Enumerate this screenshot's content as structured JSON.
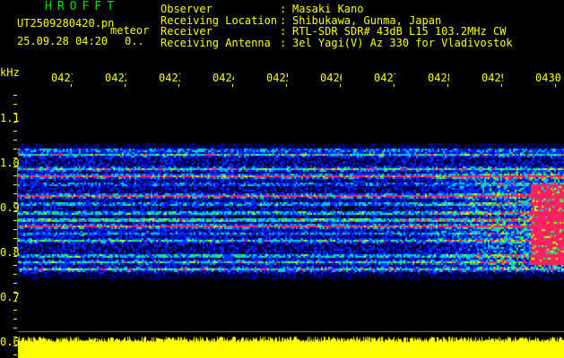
{
  "header": {
    "app_title": "HROFFT",
    "filename": "UT2509280420.pn",
    "mode": "meteor",
    "datetime": "25.09.28 04:20",
    "misc": "0..",
    "info": [
      {
        "label": "Observer",
        "value": "Masaki Kano"
      },
      {
        "label": "Receiving Location",
        "value": "Shibukawa, Gunma, Japan"
      },
      {
        "label": "Receiver",
        "value": "RTL-SDR SDR# 43dB L15 103.2MHz CW"
      },
      {
        "label": "Receiving Antenna",
        "value": "3el Yagi(V) Az 330 for Vladivostok"
      }
    ]
  },
  "axis": {
    "y_unit": "kHz",
    "y_labels": [
      "1.1",
      "1.0",
      "0.9",
      "0.8",
      "0.7",
      "0.6"
    ],
    "time_labels": [
      "0421",
      "0422",
      "0423",
      "0424",
      "0425",
      "0426",
      "0427",
      "0428",
      "0429",
      "0430"
    ]
  },
  "colors": {
    "text": "#ffff00",
    "title": "#00e000",
    "signal_red": "#ff2060",
    "signal_green": "#00ff60",
    "noise_blue": "#0020ff"
  }
}
